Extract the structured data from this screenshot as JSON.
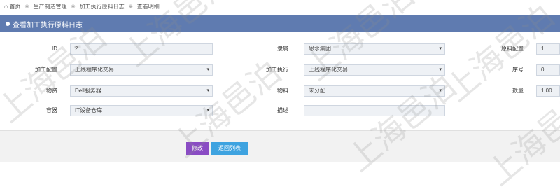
{
  "breadcrumb": {
    "items": [
      "首页",
      "生产制造管理",
      "加工执行原料日志",
      "查看明细"
    ]
  },
  "title": "查看加工执行原料日志",
  "form": {
    "id": {
      "label": "ID",
      "value": "2"
    },
    "company": {
      "label": "隶属",
      "value": "恩水集团"
    },
    "material_config": {
      "label": "原料配置",
      "value": "1"
    },
    "process_config": {
      "label": "加工配置",
      "value": "上线程序化交易"
    },
    "process_exec": {
      "label": "加工执行",
      "value": "上线程序化交易"
    },
    "sequence": {
      "label": "序号",
      "value": "0"
    },
    "goods": {
      "label": "物资",
      "value": "Dell服务器"
    },
    "material": {
      "label": "物料",
      "value": "未分配"
    },
    "quantity": {
      "label": "数量",
      "value": "1.00"
    },
    "container": {
      "label": "容器",
      "value": "IT设备仓库"
    },
    "description": {
      "label": "描述",
      "value": ""
    }
  },
  "buttons": {
    "edit": "修改",
    "back": "返回列表"
  },
  "watermark": "上海邑泊",
  "colors": {
    "title_bar": "#5f7bb0",
    "edit_button": "#8a4cc4",
    "back_button": "#3ea3e0",
    "field_bg": "#eef1f5"
  }
}
